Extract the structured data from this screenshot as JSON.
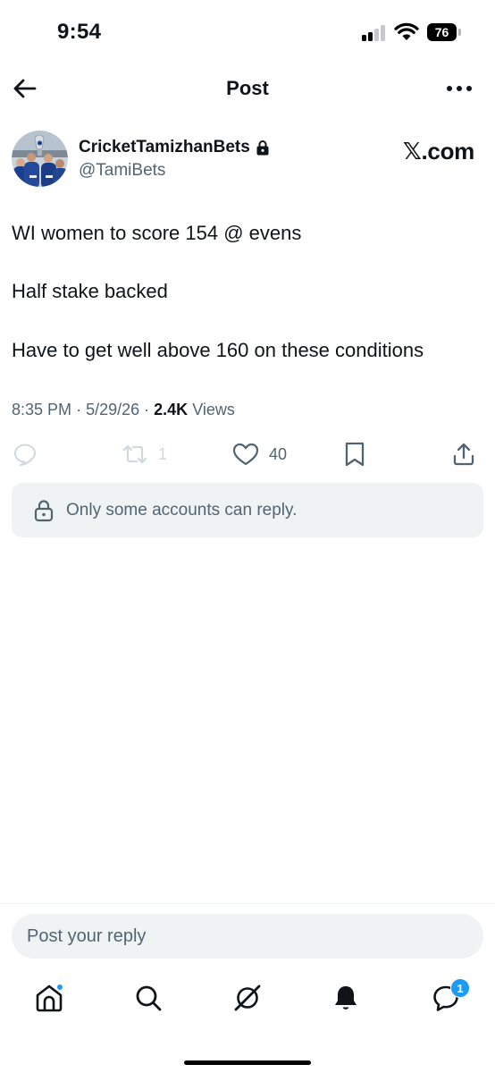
{
  "status_bar": {
    "time": "9:54",
    "battery": "76"
  },
  "header": {
    "title": "Post"
  },
  "author": {
    "display_name": "CricketTamizhanBets",
    "handle": "@TamiBets",
    "source": "𝕏.com"
  },
  "post": {
    "lines": [
      "WI women to score 154 @ evens",
      "Half stake backed",
      "Have to get well above 160 on these conditions"
    ],
    "time": "8:35 PM",
    "date": "5/29/26",
    "views_count": "2.4K",
    "views_label": "Views"
  },
  "actions": {
    "reposts": "1",
    "likes": "40"
  },
  "reply_restriction": {
    "text": "Only some accounts can reply."
  },
  "reply_box": {
    "placeholder": "Post your reply"
  },
  "tabbar": {
    "messages_badge": "1"
  },
  "icons": [
    "back-arrow-icon",
    "more-icon",
    "lock-icon",
    "reply-icon",
    "repost-icon",
    "heart-icon",
    "bookmark-icon",
    "share-icon",
    "home-icon",
    "search-icon",
    "grok-icon",
    "bell-icon",
    "messages-icon"
  ],
  "colors": {
    "accent": "#1d9bf0",
    "text": "#0f1419",
    "secondary": "#536471",
    "surface": "#eff3f4"
  }
}
